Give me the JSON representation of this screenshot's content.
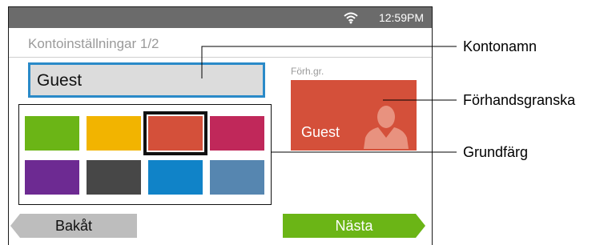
{
  "statusbar": {
    "time": "12:59PM",
    "wifi_icon": "wifi-icon"
  },
  "screen": {
    "title": "Kontoinställningar 1/2",
    "account_name_value": "Guest",
    "preview_label": "Förh.gr.",
    "preview_name": "Guest",
    "preview_color": "#d4503a",
    "palette": {
      "colors": [
        "#6bb516",
        "#f2b400",
        "#d4503a",
        "#c0285a",
        "#6d2a92",
        "#474747",
        "#1083c8",
        "#5686b0"
      ],
      "selected_index": 2
    },
    "back_label": "Bakåt",
    "next_label": "Nästa"
  },
  "callouts": {
    "account_name": "Kontonamn",
    "preview": "Förhandsgranska",
    "base_color": "Grundfärg"
  }
}
